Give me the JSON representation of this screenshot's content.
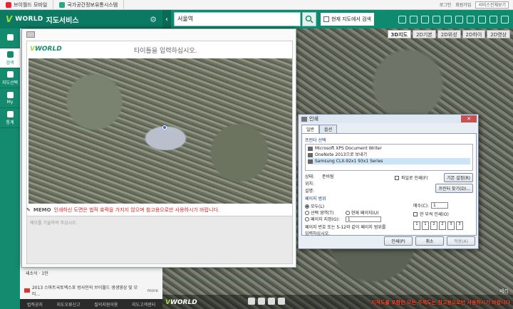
{
  "topbar": {
    "tabs": [
      "브이월드 모바일",
      "국가공간정보유통시스템"
    ],
    "login": "로그인",
    "join": "회원가입",
    "service_select": "서비스전체보기"
  },
  "header": {
    "logo_prefix": "V",
    "logo_world": "WORLD",
    "logo_title": "지도서비스",
    "search_value": "서울역",
    "search_current_map_label": "현재 지도에서 검색"
  },
  "nav": {
    "items": [
      {
        "label": ""
      },
      {
        "label": "검색"
      },
      {
        "label": "지도선택"
      },
      {
        "label": "My"
      },
      {
        "label": "통계"
      }
    ]
  },
  "map": {
    "tabs": [
      "3D지도",
      "2D기본",
      "2D위성",
      "2D하이",
      "2D영상"
    ],
    "active_tab": "3D지도",
    "logo_prefix": "V",
    "logo_world": "WORLD",
    "zoom_text": "배리",
    "notice": "지적도를 포함한 모든 주제도는 참고용으로만 사용하시기 바랍니다"
  },
  "leftpanel": {
    "news_text": "새소식 · 1만",
    "banner_text": "2013 스마트국토엑스포 방사인의 브이월드 생생영상 및 모티...",
    "banner_more": "more",
    "footer": [
      "법적공지",
      "지도오류신고",
      "질의지원이용",
      "지도고객센터"
    ]
  },
  "preview": {
    "logo_prefix": "V",
    "logo_world": "WORLD",
    "title_placeholder": "타이틀을 입력하십시오.",
    "memo_label": "MEMO",
    "memo_warning": "인쇄하신 도면은 법적 효력을 가지지 않으며 참고용으로만 사용하시기 바랍니다.",
    "memo_placeholder": "메모를 기술하여 주십시오."
  },
  "print_dialog": {
    "title": "인쇄",
    "tabs": [
      "일반",
      "옵션"
    ],
    "printer_group": "프린터 선택",
    "printers": [
      "Microsoft XPS Document Writer",
      "OneNote 2013으로 보내기",
      "Samsung CLX-92x1 93x1 Series"
    ],
    "selected_printer": "Samsung CLX-92x1 93x1 Series",
    "status_label": "상태:",
    "status_value": "준비됨",
    "location_label": "위치:",
    "comment_label": "설명:",
    "print_to_file": "파일로 인쇄(F)",
    "preferences_btn": "기본 설정(R)",
    "find_printer_btn": "프린터 찾기(D)...",
    "range_group": "페이지 범위",
    "range_all": "모두(L)",
    "range_selection": "선택 영역(T)",
    "range_current": "현재 페이지(U)",
    "range_pages": "페이지 지정(G):",
    "range_pages_value": "1",
    "range_hint": "페이지 번호 또는 5-12와 같이 페이지 범위를 입력하십시오.",
    "copies_label": "매수(C):",
    "copies_value": "1",
    "collate_label": "한 부씩 인쇄(O)",
    "print_btn": "인쇄(P)",
    "cancel_btn": "취소",
    "apply_btn": "적용(A)"
  }
}
